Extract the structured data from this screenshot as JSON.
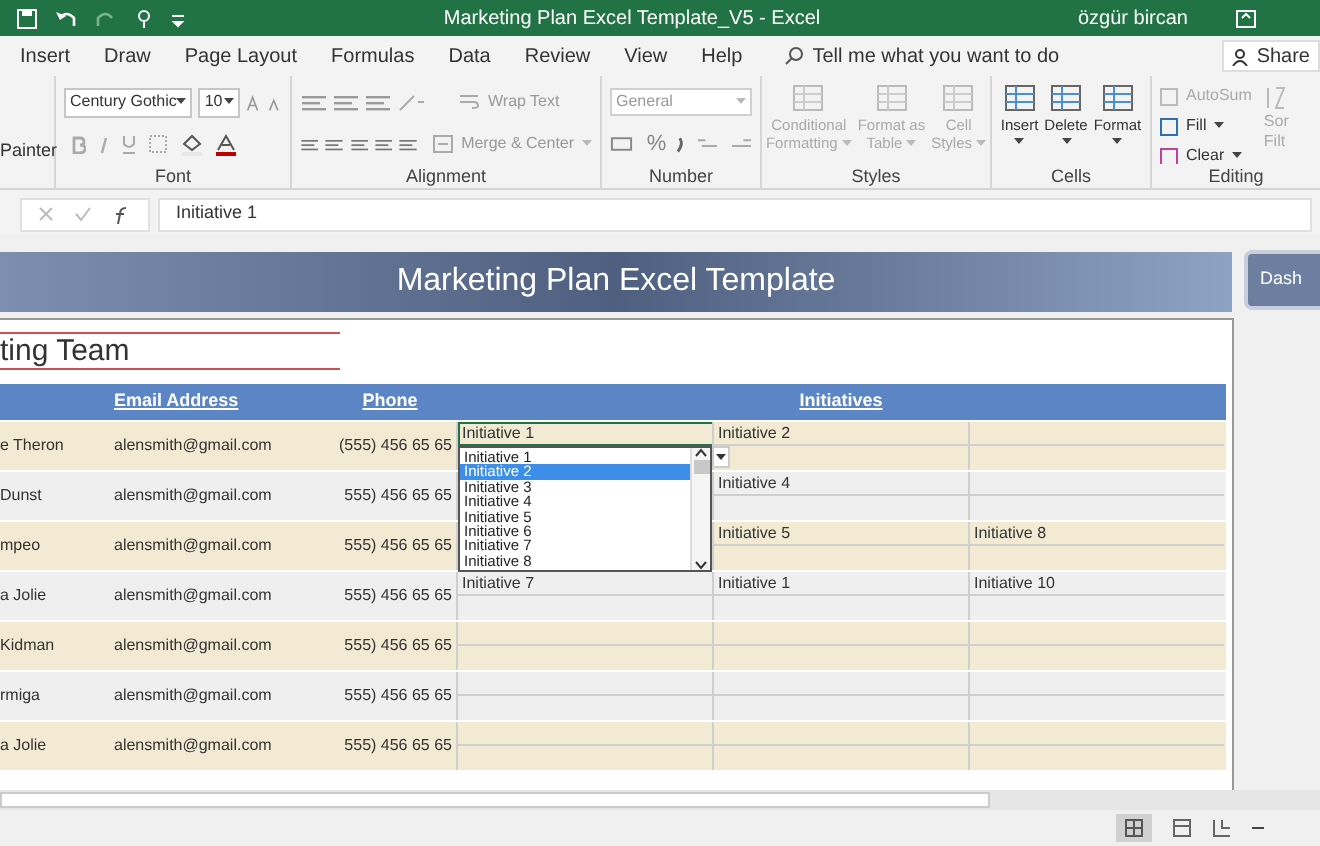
{
  "window": {
    "title": "Marketing Plan Excel Template_V5  -  Excel",
    "user": "özgür bircan"
  },
  "menu_tabs": [
    {
      "label": "Insert",
      "selected": false
    },
    {
      "label": "Draw",
      "selected": false
    },
    {
      "label": "Page Layout",
      "selected": false
    },
    {
      "label": "Formulas",
      "selected": false
    },
    {
      "label": "Data",
      "selected": false
    },
    {
      "label": "Review",
      "selected": false
    },
    {
      "label": "View",
      "selected": false
    },
    {
      "label": "Help",
      "selected": false
    }
  ],
  "tell_me": {
    "placeholder": "Tell me what you want to do"
  },
  "share_button": "Share",
  "ribbon": {
    "clipboard": {
      "painter": "Painter"
    },
    "font": {
      "label": "Font",
      "font_name": "Century Gothic",
      "font_size": "10"
    },
    "alignment": {
      "label": "Alignment",
      "wrap_text": "Wrap Text",
      "merge": "Merge & Center"
    },
    "number": {
      "label": "Number",
      "format": "General",
      "percent": "%"
    },
    "styles": {
      "label": "Styles",
      "buttons": [
        {
          "line1": "Conditional",
          "line2": "Formatting",
          "disabled": true
        },
        {
          "line1": "Format as",
          "line2": "Table",
          "disabled": true
        },
        {
          "line1": "Cell",
          "line2": "Styles",
          "disabled": true
        }
      ]
    },
    "cells": {
      "label": "Cells",
      "buttons": [
        {
          "line1": "Insert",
          "disabled": false
        },
        {
          "line1": "Delete",
          "disabled": false
        },
        {
          "line1": "Format",
          "disabled": false
        }
      ]
    },
    "editing": {
      "label": "Editing",
      "items": [
        {
          "label": "AutoSum",
          "disabled": true
        },
        {
          "label": "Fill",
          "disabled": false
        },
        {
          "label": "Clear",
          "disabled": false
        }
      ],
      "cut_button": {
        "line1": "Sor",
        "line2": "Filt"
      }
    }
  },
  "formula_bar": {
    "value": "Initiative 1"
  },
  "sheet": {
    "banner": "Marketing Plan Excel Template",
    "dashboard_button": "Dash",
    "section_title": "ting Team",
    "headers": [
      "Email Address",
      "Phone",
      "Initiatives"
    ],
    "rows": [
      {
        "name": "e Theron",
        "email": "alensmith@gmail.com",
        "phone": "(555) 456 65 65",
        "initiative_1": "Initiative 1",
        "initiative_2": "Initiative 2"
      },
      {
        "name": "Dunst",
        "email": "alensmith@gmail.com",
        "phone": "555) 456 65 65",
        "initiative_2": "Initiative 4"
      },
      {
        "name": "mpeo",
        "email": "alensmith@gmail.com",
        "phone": "555) 456 65 65",
        "initiative_2": "Initiative 5",
        "initiative_3": "Initiative 8"
      },
      {
        "name": "a Jolie",
        "email": "alensmith@gmail.com",
        "phone": "555) 456 65 65",
        "initiative_1": "Initiative 7",
        "initiative_2": "Initiative 1",
        "initiative_3": "Initiative 10"
      },
      {
        "name": "Kidman",
        "email": "alensmith@gmail.com",
        "phone": "555) 456 65 65"
      },
      {
        "name": "rmiga",
        "email": "alensmith@gmail.com",
        "phone": "555) 456 65 65"
      },
      {
        "name": "a Jolie",
        "email": "alensmith@gmail.com",
        "phone": "555) 456 65 65"
      }
    ],
    "dropdown": {
      "items": [
        {
          "label": "Initiative 1",
          "selected": false
        },
        {
          "label": "Initiative 2",
          "selected": true
        },
        {
          "label": "Initiative 3",
          "selected": false
        },
        {
          "label": "Initiative 4",
          "selected": false
        },
        {
          "label": "Initiative 5",
          "selected": false
        },
        {
          "label": "Initiative 6",
          "selected": false
        },
        {
          "label": "Initiative 7",
          "selected": false
        },
        {
          "label": "Initiative 8",
          "selected": false
        }
      ]
    }
  }
}
